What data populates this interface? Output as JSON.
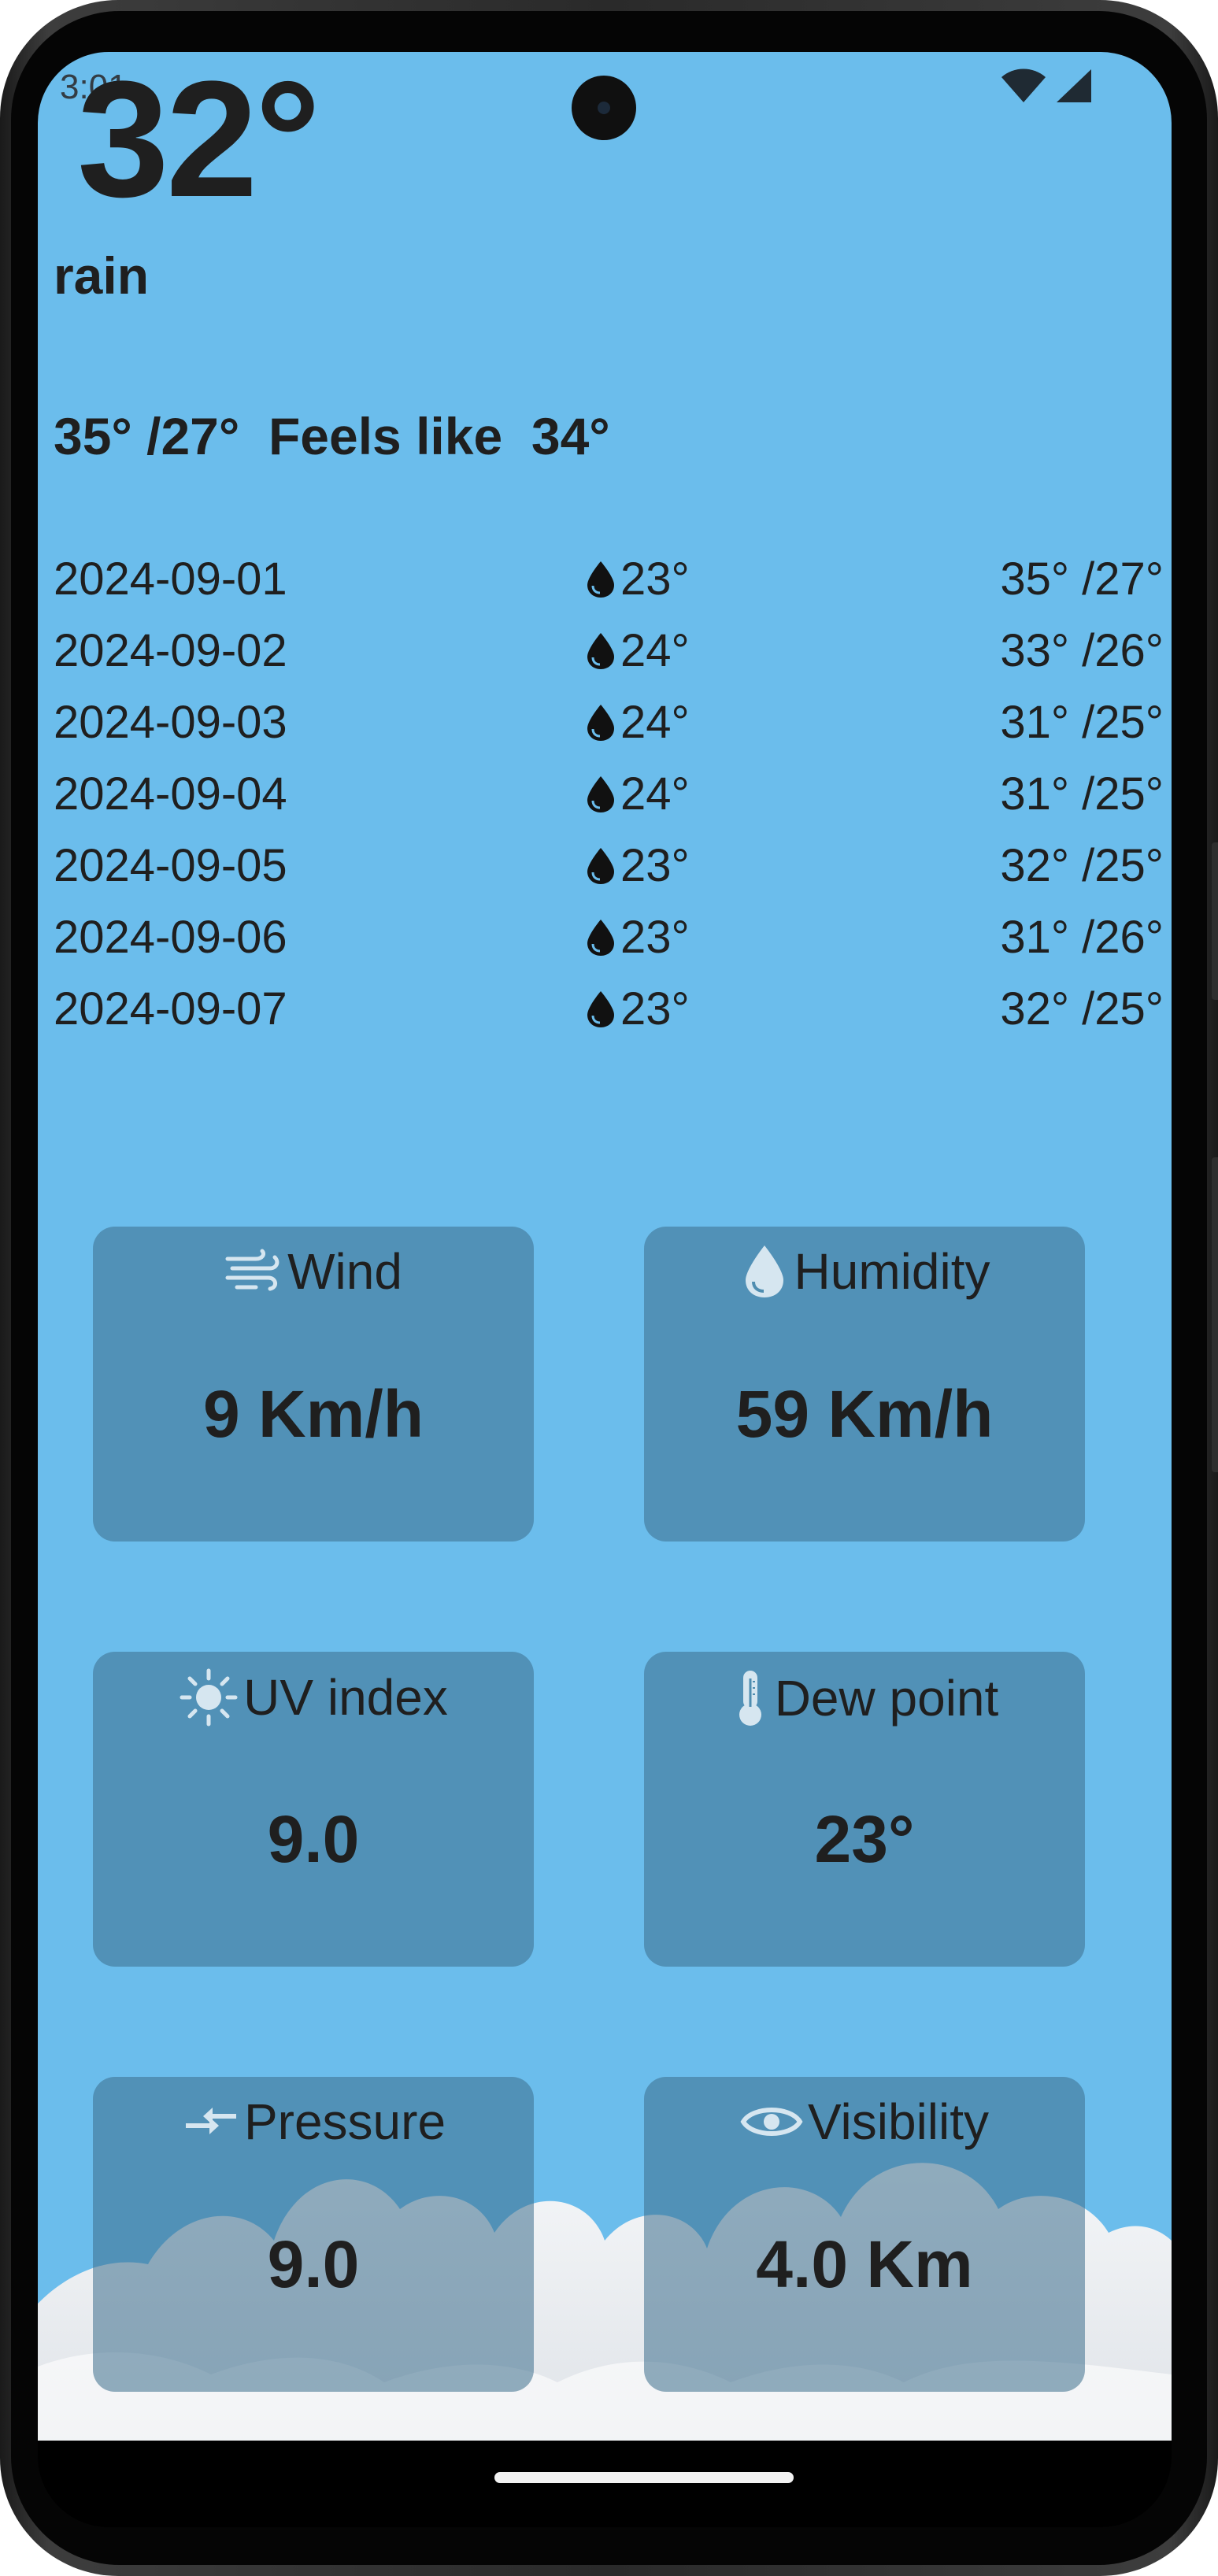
{
  "status_bar": {
    "time": "3:01"
  },
  "current": {
    "temperature": "32°",
    "condition": "rain",
    "high_low": "35° /27°",
    "feels_like_label": "Feels like",
    "feels_like_value": "34°"
  },
  "forecast": [
    {
      "date": "2024-09-01",
      "rain_temp": "23°",
      "high_low": "35° /27°"
    },
    {
      "date": "2024-09-02",
      "rain_temp": "24°",
      "high_low": "33° /26°"
    },
    {
      "date": "2024-09-03",
      "rain_temp": "24°",
      "high_low": "31° /25°"
    },
    {
      "date": "2024-09-04",
      "rain_temp": "24°",
      "high_low": "31° /25°"
    },
    {
      "date": "2024-09-05",
      "rain_temp": "23°",
      "high_low": "32° /25°"
    },
    {
      "date": "2024-09-06",
      "rain_temp": "23°",
      "high_low": "31° /26°"
    },
    {
      "date": "2024-09-07",
      "rain_temp": "23°",
      "high_low": "32° /25°"
    }
  ],
  "cards": {
    "wind": {
      "label": "Wind",
      "value": "9 Km/h",
      "icon": "wind-icon"
    },
    "humidity": {
      "label": "Humidity",
      "value": "59 Km/h",
      "icon": "droplet-icon"
    },
    "uv": {
      "label": "UV index",
      "value": "9.0",
      "icon": "sun-icon"
    },
    "dew": {
      "label": "Dew point",
      "value": "23°",
      "icon": "thermometer-icon"
    },
    "pressure": {
      "label": "Pressure",
      "value": "9.0",
      "icon": "pressure-arrows-icon"
    },
    "visibility": {
      "label": "Visibility",
      "value": "4.0 Km",
      "icon": "eye-icon"
    }
  },
  "colors": {
    "sky_background": "#6bbdec",
    "card_background": "#4f8db0",
    "text": "#1f1f1f",
    "icon_light": "#d6e6f0"
  }
}
